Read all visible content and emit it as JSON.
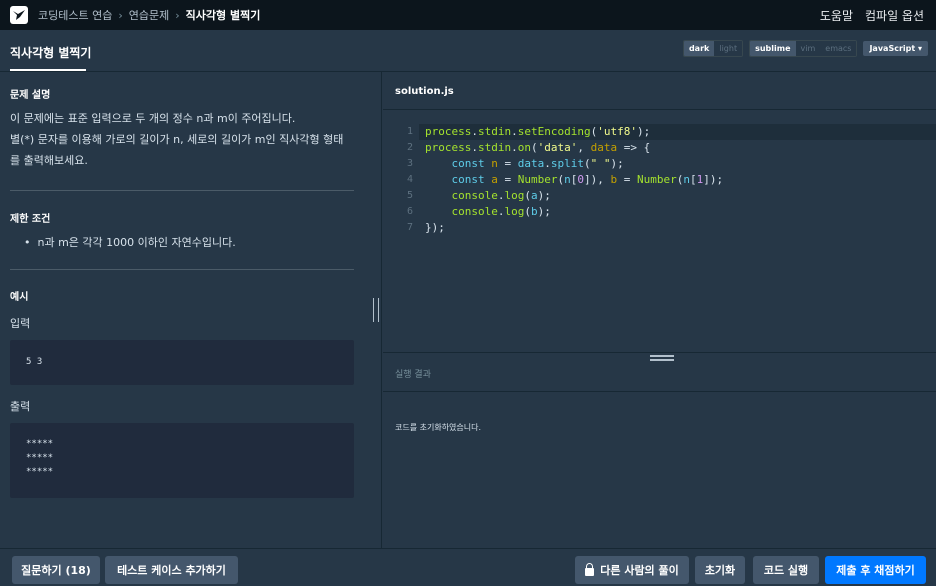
{
  "nav": {
    "breadcrumbs": [
      "코딩테스트 연습",
      "연습문제",
      "직사각형 별찍기"
    ],
    "help": "도움말",
    "compile_options": "컴파일 옵션"
  },
  "tab": {
    "title": "직사각형 별찍기"
  },
  "settings": {
    "themes": [
      "dark",
      "light"
    ],
    "theme_selected": "dark",
    "keymaps": [
      "sublime",
      "vim",
      "emacs"
    ],
    "keymap_selected": "sublime",
    "language": "JavaScript"
  },
  "problem": {
    "description_heading": "문제 설명",
    "description_lines": [
      "이 문제에는 표준 입력으로 두 개의 정수 n과 m이 주어집니다.",
      "별(*) 문자를 이용해 가로의 길이가 n, 세로의 길이가 m인 직사각형 형태",
      "를 출력해보세요."
    ],
    "constraints_heading": "제한 조건",
    "constraints": [
      "n과 m은 각각 1000 이하인 자연수입니다."
    ],
    "example_heading": "예시",
    "input_label": "입력",
    "input_lines": [
      "5 3"
    ],
    "output_label": "출력",
    "output_lines": [
      "*****",
      "*****",
      "*****"
    ]
  },
  "editor": {
    "file_name": "solution.js",
    "line_numbers": [
      "1",
      "2",
      "3",
      "4",
      "5",
      "6",
      "7"
    ]
  },
  "result": {
    "heading": "실행 결과",
    "message": "코드를 초기화하였습니다."
  },
  "buttons": {
    "questions": "질문하기 (18)",
    "add_test_case": "테스트 케이스 추가하기",
    "others_solutions": "다른 사람의 풀이",
    "reset": "초기화",
    "run": "코드 실행",
    "submit": "제출 후 채점하기"
  },
  "colors": {
    "background": "#263747",
    "nav_background": "#0c151c",
    "primary_button": "#0078ff",
    "secondary_button": "#44576c"
  }
}
